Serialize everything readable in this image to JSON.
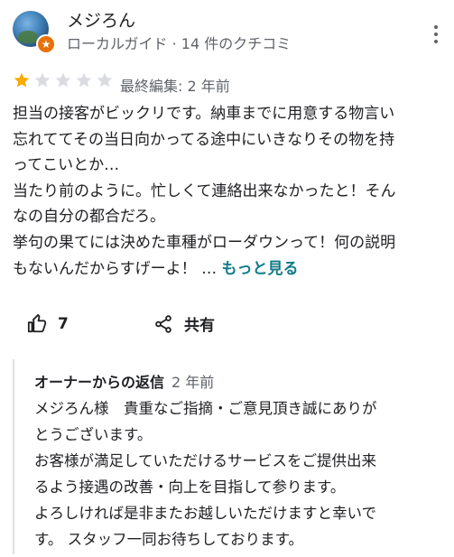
{
  "reviewer": {
    "name": "メジろん",
    "subtitle": "ローカルガイド · 14 件のクチコミ",
    "badge_glyph": "★",
    "icon_names": {
      "menu": "more-vert-icon",
      "badge": "local-guide-badge-icon"
    }
  },
  "rating": {
    "value": 1,
    "max": 5,
    "filled_color": "#f9ab00",
    "empty_color": "#dadce0"
  },
  "edited": "最終編集: 2 年前",
  "review_lines": [
    "担当の接客がビックリです。納車までに用意する物言い",
    "忘れててその当日向かってる途中にいきなりその物を持",
    "ってこいとか…",
    "当たり前のように。忙しくて連絡出来なかったと！そん",
    "なの自分の都合だろ。",
    "挙句の果てには決めた車種がローダウンって！何の説明",
    "もないんだからすげーよ！ …"
  ],
  "read_more": "もっと見る",
  "actions": {
    "like_count": "7",
    "share_label": "共有",
    "like_icon": "thumb-up-icon",
    "share_icon": "share-icon"
  },
  "owner_reply": {
    "title": "オーナーからの返信",
    "date": "2 年前",
    "lines": [
      "メジろん様　貴重なご指摘・ご意見頂き誠にありが",
      "とうございます。",
      " お客様が満足していただけるサービスをご提供出来",
      "るよう接遇の改善・向上を目指して参ります。",
      " よろしければ是非またお越しいただけますと幸いで",
      "す。 スタッフ一同お待ちしております。"
    ]
  }
}
